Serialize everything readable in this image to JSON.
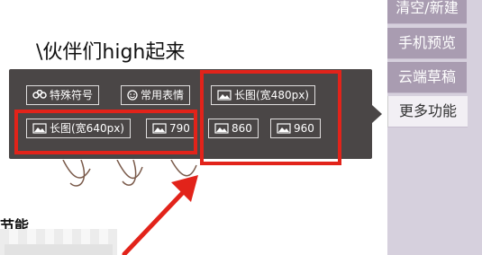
{
  "article": {
    "title": "\\伙伴们high起来",
    "bottom_text": "节能"
  },
  "side_menu": {
    "items": [
      {
        "label": "清空/新建"
      },
      {
        "label": "手机预览"
      },
      {
        "label": "云端草稿"
      },
      {
        "label": "更多功能",
        "active": true
      }
    ]
  },
  "popup": {
    "buttons": [
      {
        "icon": "link-icon",
        "label": "特殊符号"
      },
      {
        "icon": "smiley-icon",
        "label": "常用表情"
      },
      {
        "icon": "image-icon",
        "label": "长图(宽480px)"
      },
      {
        "icon": "image-icon",
        "label": "长图(宽640px)"
      },
      {
        "icon": "image-icon",
        "label": "790"
      },
      {
        "icon": "image-icon",
        "label": "860"
      },
      {
        "icon": "image-icon",
        "label": "960"
      }
    ]
  },
  "colors": {
    "popup_bg": "#4a4646",
    "annotation_red": "#e2231a",
    "side_menu_item": "#a99cb1",
    "side_menu_active": "#f2eff4"
  }
}
